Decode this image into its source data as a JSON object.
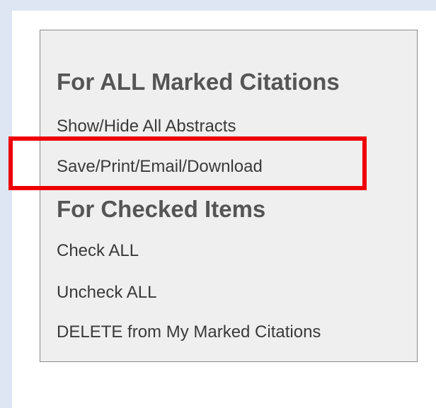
{
  "panel": {
    "all_heading": "For ALL Marked Citations",
    "all_links": {
      "show_hide_abstracts": "Show/Hide All Abstracts",
      "save_print_email_download": "Save/Print/Email/Download"
    },
    "checked_heading": "For Checked Items",
    "checked_links": {
      "check_all": "Check ALL",
      "uncheck_all": "Uncheck ALL",
      "delete_marked": "DELETE from My Marked Citations"
    }
  },
  "highlight": {
    "target": "save_print_email_download",
    "color": "#ee0000"
  }
}
